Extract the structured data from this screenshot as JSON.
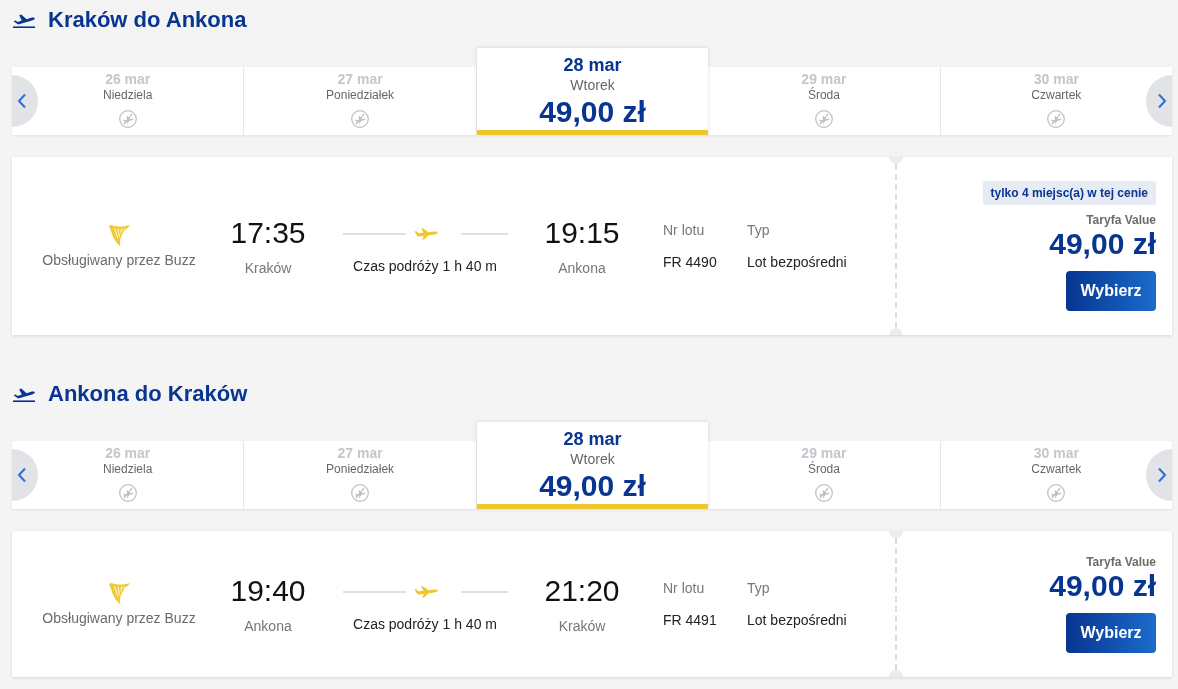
{
  "sections": [
    {
      "title": "Kraków do Ankona",
      "date_strip": {
        "days": [
          {
            "date": "26 mar",
            "weekday": "Niedziela",
            "selected": false
          },
          {
            "date": "27 mar",
            "weekday": "Poniedziałek",
            "selected": false
          },
          {
            "date": "28 mar",
            "weekday": "Wtorek",
            "price": "49,00 zł",
            "selected": true
          },
          {
            "date": "29 mar",
            "weekday": "Środa",
            "selected": false
          },
          {
            "date": "30 mar",
            "weekday": "Czwartek",
            "selected": false
          }
        ]
      },
      "flight": {
        "operator": "Obsługiwany przez Buzz",
        "departure": {
          "time": "17:35",
          "city": "Kraków"
        },
        "duration": "Czas podróży 1 h 40 m",
        "arrival": {
          "time": "19:15",
          "city": "Ankona"
        },
        "flight_number": {
          "label": "Nr lotu",
          "value": "FR 4490"
        },
        "flight_type": {
          "label": "Typ",
          "value": "Lot bezpośredni"
        },
        "badge": "tylko 4 miejsc(a) w tej cenie",
        "fare": "Taryfa Value",
        "price": "49,00 zł",
        "button": "Wybierz"
      }
    },
    {
      "title": "Ankona do Kraków",
      "date_strip": {
        "days": [
          {
            "date": "26 mar",
            "weekday": "Niedziela",
            "selected": false
          },
          {
            "date": "27 mar",
            "weekday": "Poniedziałek",
            "selected": false
          },
          {
            "date": "28 mar",
            "weekday": "Wtorek",
            "price": "49,00 zł",
            "selected": true
          },
          {
            "date": "29 mar",
            "weekday": "Środa",
            "selected": false
          },
          {
            "date": "30 mar",
            "weekday": "Czwartek",
            "selected": false
          }
        ]
      },
      "flight": {
        "operator": "Obsługiwany przez Buzz",
        "departure": {
          "time": "19:40",
          "city": "Ankona"
        },
        "duration": "Czas podróży 1 h 40 m",
        "arrival": {
          "time": "21:20",
          "city": "Kraków"
        },
        "flight_number": {
          "label": "Nr lotu",
          "value": "FR 4491"
        },
        "flight_type": {
          "label": "Typ",
          "value": "Lot bezpośredni"
        },
        "fare": "Taryfa Value",
        "price": "49,00 zł",
        "button": "Wybierz"
      }
    }
  ]
}
